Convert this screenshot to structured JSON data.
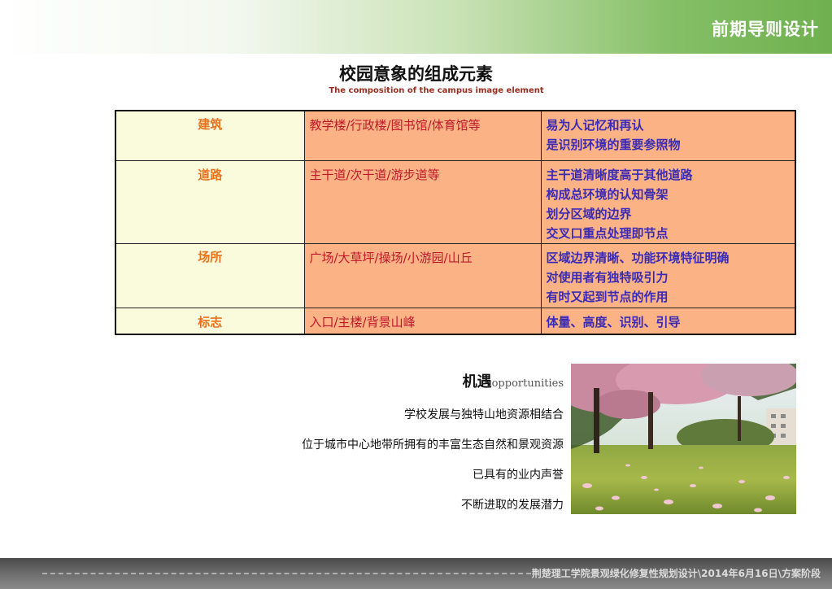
{
  "header": {
    "title": "前期导则设计"
  },
  "page": {
    "title": "校园意象的组成元素",
    "subtitle": "The composition of the campus image element"
  },
  "table": {
    "rows": [
      {
        "category": "建筑",
        "items": "教学楼/行政楼/图书馆/体育馆等",
        "notes": [
          "易为人记忆和再认",
          "是识别环境的重要参照物"
        ]
      },
      {
        "category": "道路",
        "items": "主干道/次干道/游步道等",
        "notes": [
          "主干道清晰度高于其他道路",
          "构成总环境的认知骨架",
          "划分区域的边界",
          "交叉口重点处理即节点"
        ]
      },
      {
        "category": "场所",
        "items": "广场/大草坪/操场/小游园/山丘",
        "notes": [
          "区域边界清晰、功能环境特征明确",
          "对使用者有独特吸引力",
          "有时又起到节点的作用"
        ]
      },
      {
        "category": "标志",
        "items": "入口/主楼/背景山峰",
        "notes": [
          "体量、高度、识别、引导"
        ]
      }
    ]
  },
  "opportunities": {
    "title_cn": "机遇",
    "title_en": "opportunities",
    "items": [
      "学校发展与独特山地资源相结合",
      "位于城市中心地带所拥有的丰富生态自然和景观资源",
      "已具有的业内声誉",
      "不断进取的发展潜力"
    ]
  },
  "footer": {
    "text": "荆楚理工学院景观绿化修复性规划设计\\2014年6月16日\\方案阶段"
  },
  "colors": {
    "header_green": "#6fb04f",
    "category_text": "#e8731c",
    "category_bg": "#fafadc",
    "cell_bg": "#fbb386",
    "items_text": "#c0182a",
    "notes_text": "#3a2ab5"
  }
}
